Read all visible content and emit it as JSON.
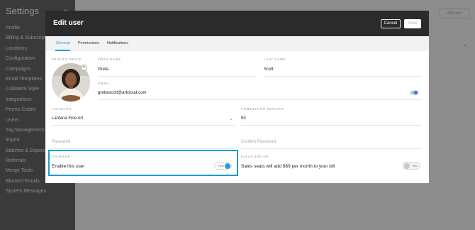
{
  "sidebar": {
    "title": "Settings",
    "items": [
      "Profile",
      "Billing & Subscriptions",
      "Locations",
      "Configuration",
      "Campaigns",
      "Email Templates",
      "Collateral Style",
      "Integrations",
      "Promo Codes",
      "Users",
      "Tag Management",
      "Import",
      "Batches & Exports",
      "Referrals",
      "Merge Tools",
      "Blocked Emails",
      "System Messages"
    ]
  },
  "background": {
    "add_user_label": "Add User"
  },
  "modal": {
    "title": "Edit user",
    "cancel_label": "Cancel",
    "save_label": "Save",
    "tabs": [
      "General",
      "Permissions",
      "Notifications"
    ],
    "profile_image_label": "PROFILE IMAGE",
    "first_name_label": "FIRST NAME",
    "first_name_value": "Greta",
    "last_name_label": "LAST NAME",
    "last_name_value": "Scott",
    "email_label": "EMAIL",
    "email_value": "grettascott@artcloud.com",
    "location_label": "LOCATION",
    "location_value": "Lantana Fine Art",
    "commission_label": "COMMISSION PERCENT",
    "commission_value": "50",
    "password_placeholder": "Password",
    "confirm_password_placeholder": "Confirm Password",
    "enabled_label": "ENABLED",
    "enabled_text": "Enable this user",
    "enabled_toggle_text": "YES",
    "enabled_state": true,
    "sales_addon_label": "SALES ADD ON",
    "sales_addon_text": "Sales seats will add $69 per month to your bill",
    "sales_toggle_text": "NO",
    "sales_state": false
  },
  "colors": {
    "accent": "#1ea0dc",
    "header": "#2b2b2b",
    "highlight": "#1c9bd6"
  }
}
